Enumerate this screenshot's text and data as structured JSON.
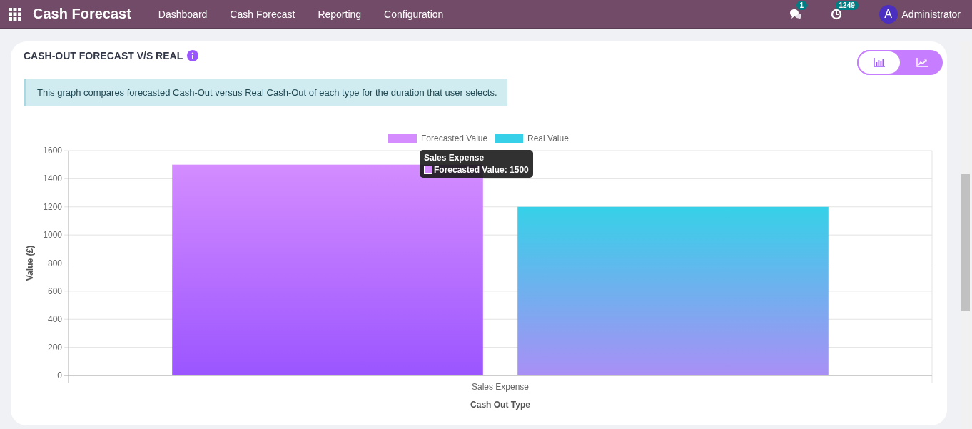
{
  "navbar": {
    "app_title": "Cash Forecast",
    "menu": [
      {
        "label": "Dashboard"
      },
      {
        "label": "Cash Forecast"
      },
      {
        "label": "Reporting"
      },
      {
        "label": "Configuration"
      }
    ],
    "messages_count": "1",
    "activities_count": "1249",
    "user": {
      "initial": "A",
      "name": "Administrator"
    }
  },
  "card": {
    "title": "CASH-OUT FORECAST V/S REAL",
    "view_toggle": [
      {
        "kind": "bar",
        "selected": true
      },
      {
        "kind": "line",
        "selected": false
      }
    ],
    "description": "This graph compares forecasted Cash-Out versus Real Cash-Out of each type for the duration that user selects.",
    "chart_data": {
      "type": "bar",
      "xlabel": "Cash Out Type",
      "ylabel": "Value (£)",
      "categories": [
        "Sales Expense"
      ],
      "series": [
        {
          "name": "Forecasted Value",
          "color": "#d48cff",
          "values": [
            1500
          ]
        },
        {
          "name": "Real Value",
          "color": "#36d1e8",
          "values": [
            1200
          ]
        }
      ],
      "grid": true,
      "legend": true,
      "ylim": [
        0,
        1600
      ],
      "yticks": [
        0,
        200,
        400,
        600,
        800,
        1000,
        1200,
        1400,
        1600
      ]
    },
    "tooltip": {
      "title": "Sales Expense",
      "label": "Forecasted Value: 1500"
    }
  }
}
